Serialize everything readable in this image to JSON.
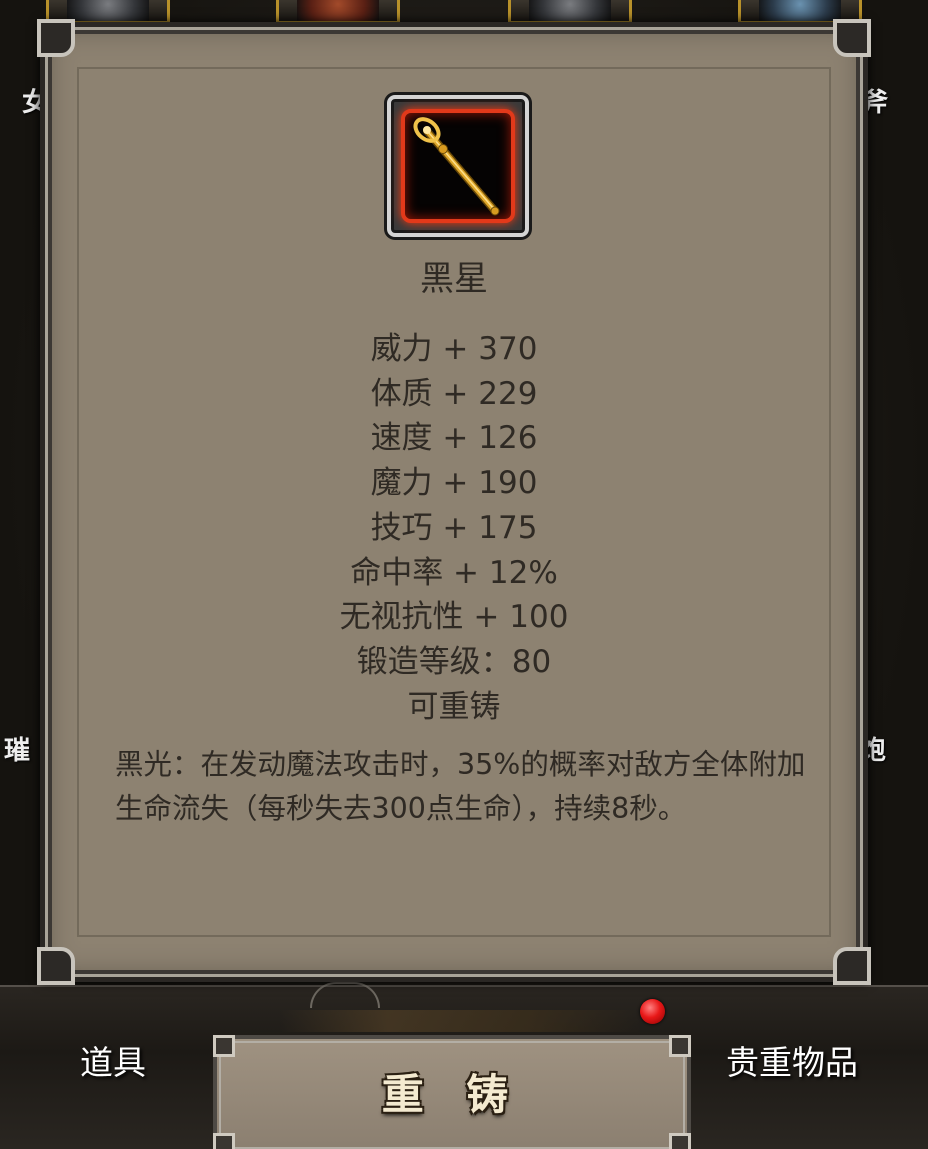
{
  "background": {
    "side_labels": {
      "left_top": "女",
      "right_top": "斧",
      "left_mid": "璀",
      "right_mid": "饱"
    },
    "top_slots": [
      {
        "icon": "armor-gauntlet-icon"
      },
      {
        "icon": "dragon-helm-icon"
      },
      {
        "icon": "silver-beast-icon"
      },
      {
        "icon": "blue-dragon-icon"
      }
    ]
  },
  "tooltip": {
    "item_icon": "golden-scepter-icon",
    "item_name": "黑星",
    "stats": [
      "威力 + 370",
      "体质 + 229",
      "速度 + 126",
      "魔力 + 190",
      "技巧 + 175",
      "命中率 + 12%",
      "无视抗性 + 100",
      "锻造等级：80",
      "可重铸"
    ],
    "description": "黑光：在发动魔法攻击时，35%的概率对敌方全体附加生命流失（每秒失去300点生命），持续8秒。"
  },
  "bottom": {
    "tab_items": "道具",
    "tab_valuables": "贵重物品",
    "reforge_button": "重 铸",
    "notification": "red-dot-badge"
  },
  "colors": {
    "panel_bg": "#8d8271",
    "text": "#2f2a24",
    "icon_border_red": "#e2391a",
    "notification_red": "#e81818"
  }
}
